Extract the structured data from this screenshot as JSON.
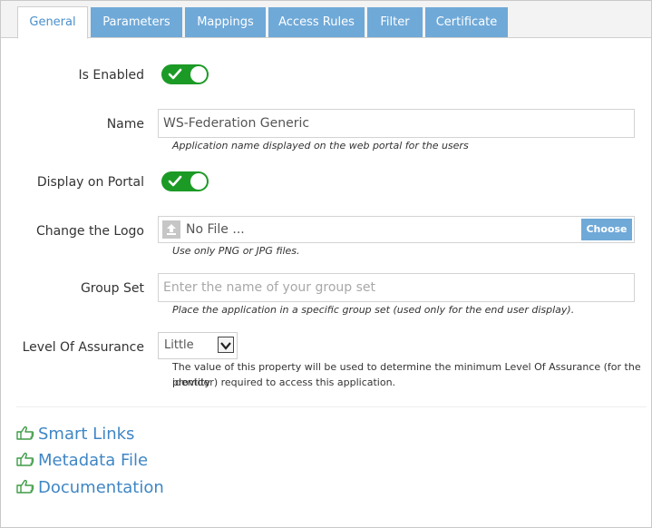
{
  "tabs": [
    {
      "label": "General",
      "active": true
    },
    {
      "label": "Parameters",
      "active": false
    },
    {
      "label": "Mappings",
      "active": false
    },
    {
      "label": "Access Rules",
      "active": false
    },
    {
      "label": "Filter",
      "active": false
    },
    {
      "label": "Certificate",
      "active": false
    }
  ],
  "form": {
    "is_enabled": {
      "label": "Is Enabled",
      "value": true
    },
    "name": {
      "label": "Name",
      "value": "WS-Federation Generic",
      "help": "Application name displayed on the web portal for the users"
    },
    "display_on_portal": {
      "label": "Display on Portal",
      "value": true
    },
    "logo": {
      "label": "Change the Logo",
      "file_text": "No File ...",
      "button_label": "Choose",
      "help": "Use only PNG or JPG files."
    },
    "group_set": {
      "label": "Group Set",
      "placeholder": "Enter the name of your group set",
      "help": "Place the application in a specific group set (used only for the end user display)."
    },
    "level_of_assurance": {
      "label": "Level Of Assurance",
      "selected": "Little",
      "help_line1": "The value of this property will be used to determine the minimum Level Of Assurance (for the identity",
      "help_line2": "provider) required to access this application."
    }
  },
  "links": [
    {
      "label": "Smart Links",
      "icon": "thumbs-up-icon"
    },
    {
      "label": "Metadata File",
      "icon": "thumbs-up-icon"
    },
    {
      "label": "Documentation",
      "icon": "thumbs-up-icon"
    }
  ],
  "colors": {
    "accent": "#6fa9d8",
    "toggle_on": "#1c9a26",
    "link": "#3f86c5"
  }
}
